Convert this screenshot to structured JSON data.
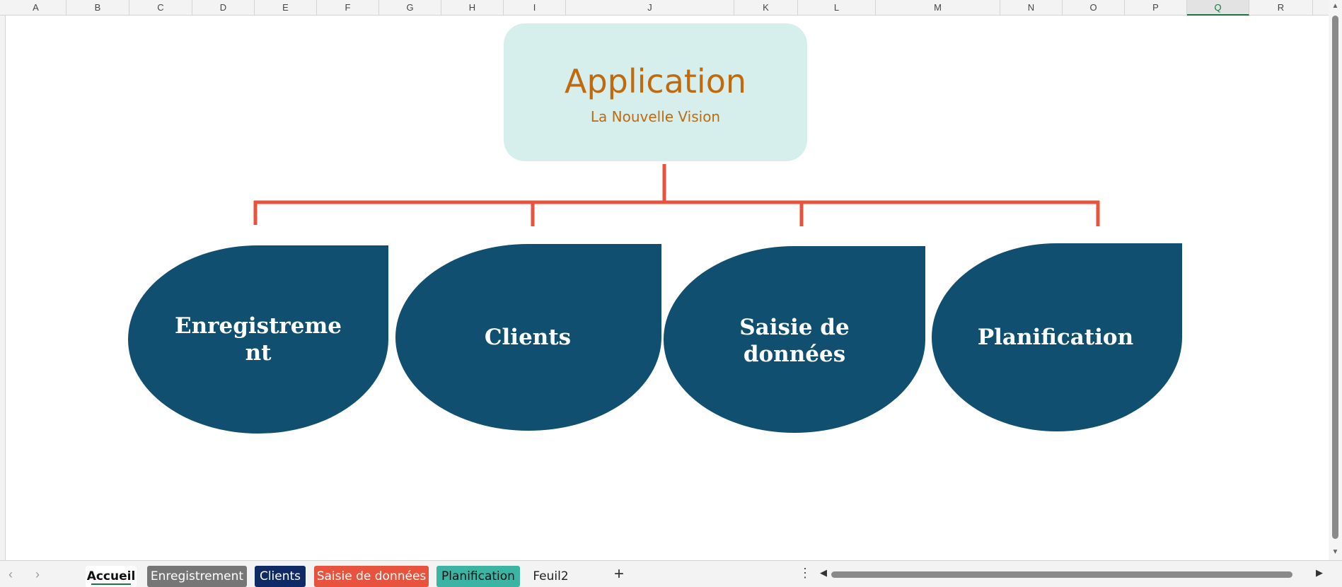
{
  "columns": [
    "A",
    "B",
    "C",
    "D",
    "E",
    "F",
    "G",
    "H",
    "I",
    "J",
    "K",
    "L",
    "M",
    "N",
    "O",
    "P",
    "Q",
    "R"
  ],
  "active_column": "Q",
  "diagram": {
    "title": "Application",
    "subtitle": "La Nouvelle Vision",
    "nodes": [
      "Enregistreme\nnt",
      "Clients",
      "Saisie de\ndonnées",
      "Planification"
    ],
    "colors": {
      "title_box": "#d6efec",
      "title_text": "#c06a0d",
      "connector": "#e8533d",
      "node_fill": "#104f6f"
    }
  },
  "sheet_tabs": [
    {
      "label": "Accueil",
      "active": true
    },
    {
      "label": "Enregistrement",
      "color": "#767676"
    },
    {
      "label": "Clients",
      "color": "#0f2a64"
    },
    {
      "label": "Saisie de données",
      "color": "#e8533d"
    },
    {
      "label": "Planification",
      "color": "#3cb4a4"
    },
    {
      "label": "Feuil2"
    }
  ],
  "icons": {
    "prev_sheet": "chevron-left-icon",
    "next_sheet": "chevron-right-icon",
    "add_sheet": "plus-icon",
    "more": "more-vertical-icon"
  },
  "glyphs": {
    "prev": "‹",
    "next": "›",
    "add": "+",
    "more": "⋮",
    "scroll_left": "◀",
    "scroll_right": "▶",
    "scroll_up": "▲",
    "scroll_down": "▼"
  }
}
